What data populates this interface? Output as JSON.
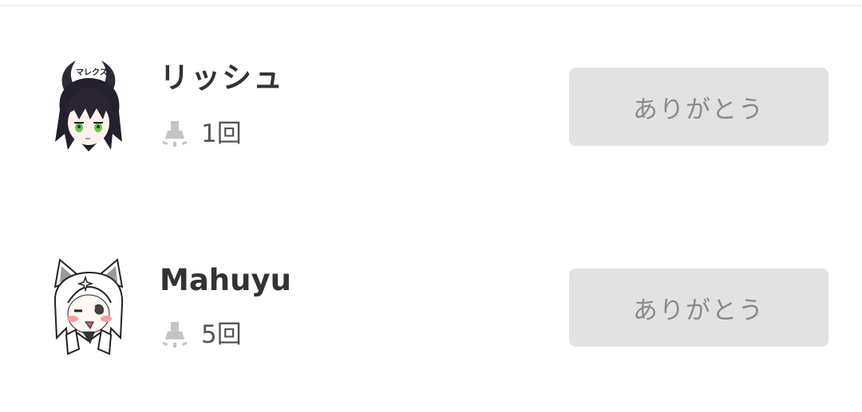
{
  "supporters": [
    {
      "name": "リッシュ",
      "count": "1回",
      "avatar": "demon-horn-character-avatar",
      "avatar_text": "マレクス",
      "count_icon": "flashlight-icon",
      "button_label": "ありがとう"
    },
    {
      "name": "Mahuyu",
      "count": "5回",
      "avatar": "white-cat-ear-character-avatar",
      "count_icon": "flashlight-icon",
      "button_label": "ありがとう"
    }
  ],
  "colors": {
    "button_bg": "#e2e2e2",
    "button_text": "#8a8a8a",
    "name_text": "#333333",
    "icon": "#c4c4c4"
  }
}
